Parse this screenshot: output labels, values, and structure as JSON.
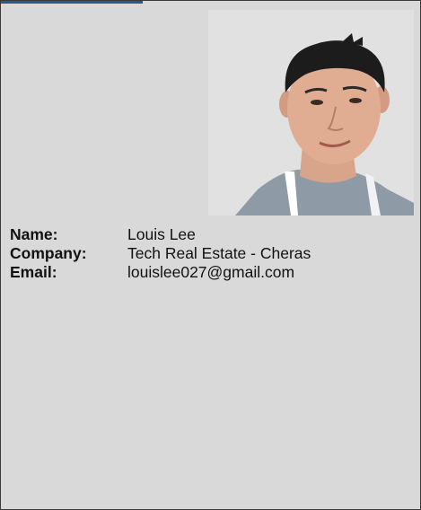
{
  "profile": {
    "photo_icon": "person-photo",
    "fields": [
      {
        "label": "Name:",
        "value": "Louis Lee"
      },
      {
        "label": "Company:",
        "value": "Tech Real Estate - Cheras"
      },
      {
        "label": "Email:",
        "value": "louislee027@gmail.com"
      }
    ]
  },
  "colors": {
    "card_background": "#d9d9d9",
    "border": "#3a3a3a",
    "accent": "#2a5a8a"
  }
}
